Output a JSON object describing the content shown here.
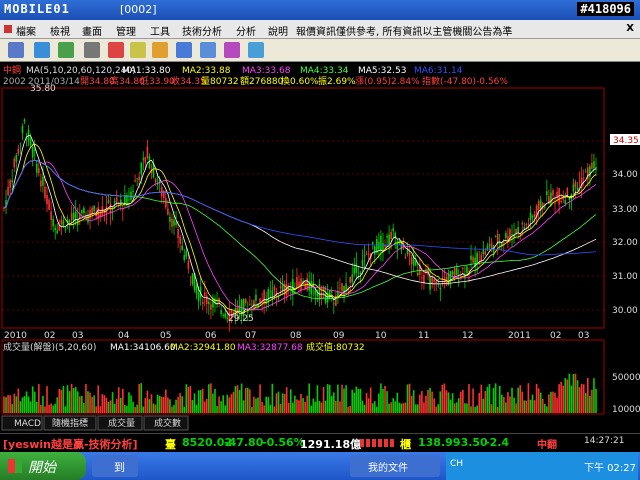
{
  "window": {
    "watermark": "MOBILE01",
    "title": "[0002]",
    "reference": "#418096"
  },
  "menu": [
    "檔案",
    "檢視",
    "畫面",
    "管理",
    "工具",
    "技術分析",
    "分析",
    "說明",
    "報價資訊僅供參考, 所有資訊以主管機關公告為準"
  ],
  "menu_close": "X",
  "chart_header": {
    "line1": {
      "name": "中鋼",
      "ma_spec": "MA(5,10,20,60,120,240)",
      "ma1": "MA1:33.80",
      "ma2": "MA2:33.88",
      "ma3": "MA3:33.68",
      "ma4": "MA4:33.34",
      "ma5": "MA5:32.53",
      "ma6": "MA6:31.14"
    },
    "line2": {
      "code": "2002",
      "date": "2011/03/14",
      "open": "開34.80",
      "high": "高34.80",
      "low": "低33.90",
      "close": "收34.35",
      "volume": "量80732",
      "amount": "額276880",
      "turnover": "換0.60%",
      "amplitude": "振2.69%",
      "change": "漲(0.95)2.84%",
      "index": "指數(-47.80)-0.56%"
    }
  },
  "price_chart": {
    "current": "34.35",
    "high_label": "35.80",
    "low_label": "29.25",
    "y_ticks": [
      "35.00",
      "34.00",
      "33.00",
      "32.00",
      "31.00",
      "30.00"
    ],
    "x_labels": [
      "2010",
      "02",
      "03",
      "04",
      "05",
      "06",
      "07",
      "08",
      "09",
      "10",
      "11",
      "12",
      "2011",
      "02",
      "03"
    ]
  },
  "volume_panel": {
    "header": "成交量(解盤)(5,20,60)",
    "ma1": "MA1:34106.60",
    "ma2": "MA2:32941.80",
    "ma3": "MA3:32877.68",
    "current": "成交值:80732",
    "y_ticks": [
      "50000",
      "10000"
    ]
  },
  "tabs": [
    "MACD",
    "隨機指標",
    "成交量",
    "成交數"
  ],
  "ticker": {
    "brand": "[yeswin越是贏-技術分析]",
    "left_label": "臺",
    "taiex": "8520.02",
    "taiex_chg": "-47.80",
    "taiex_pct": "-0.56%",
    "amount": "1291.18億",
    "right_label": "櫃",
    "otc": "138.99",
    "otc_chg": "-3.50",
    "otc_pct": "-2.4",
    "flag": "中翻",
    "time": "14:27:21"
  },
  "taskbar": {
    "start": "開始",
    "app1": "到",
    "app2": "我的文件",
    "lang": "CH",
    "clock": "下午 02:27"
  },
  "colors": {
    "up": "#ff3030",
    "down": "#00d000",
    "ma1": "#ffffff",
    "ma2": "#ffff00",
    "ma3": "#ff40ff",
    "ma4": "#40ff40",
    "ma5": "#ffffff",
    "ma6": "#3050ff",
    "axis": "#a00000",
    "label_up": "#ff4040"
  }
}
